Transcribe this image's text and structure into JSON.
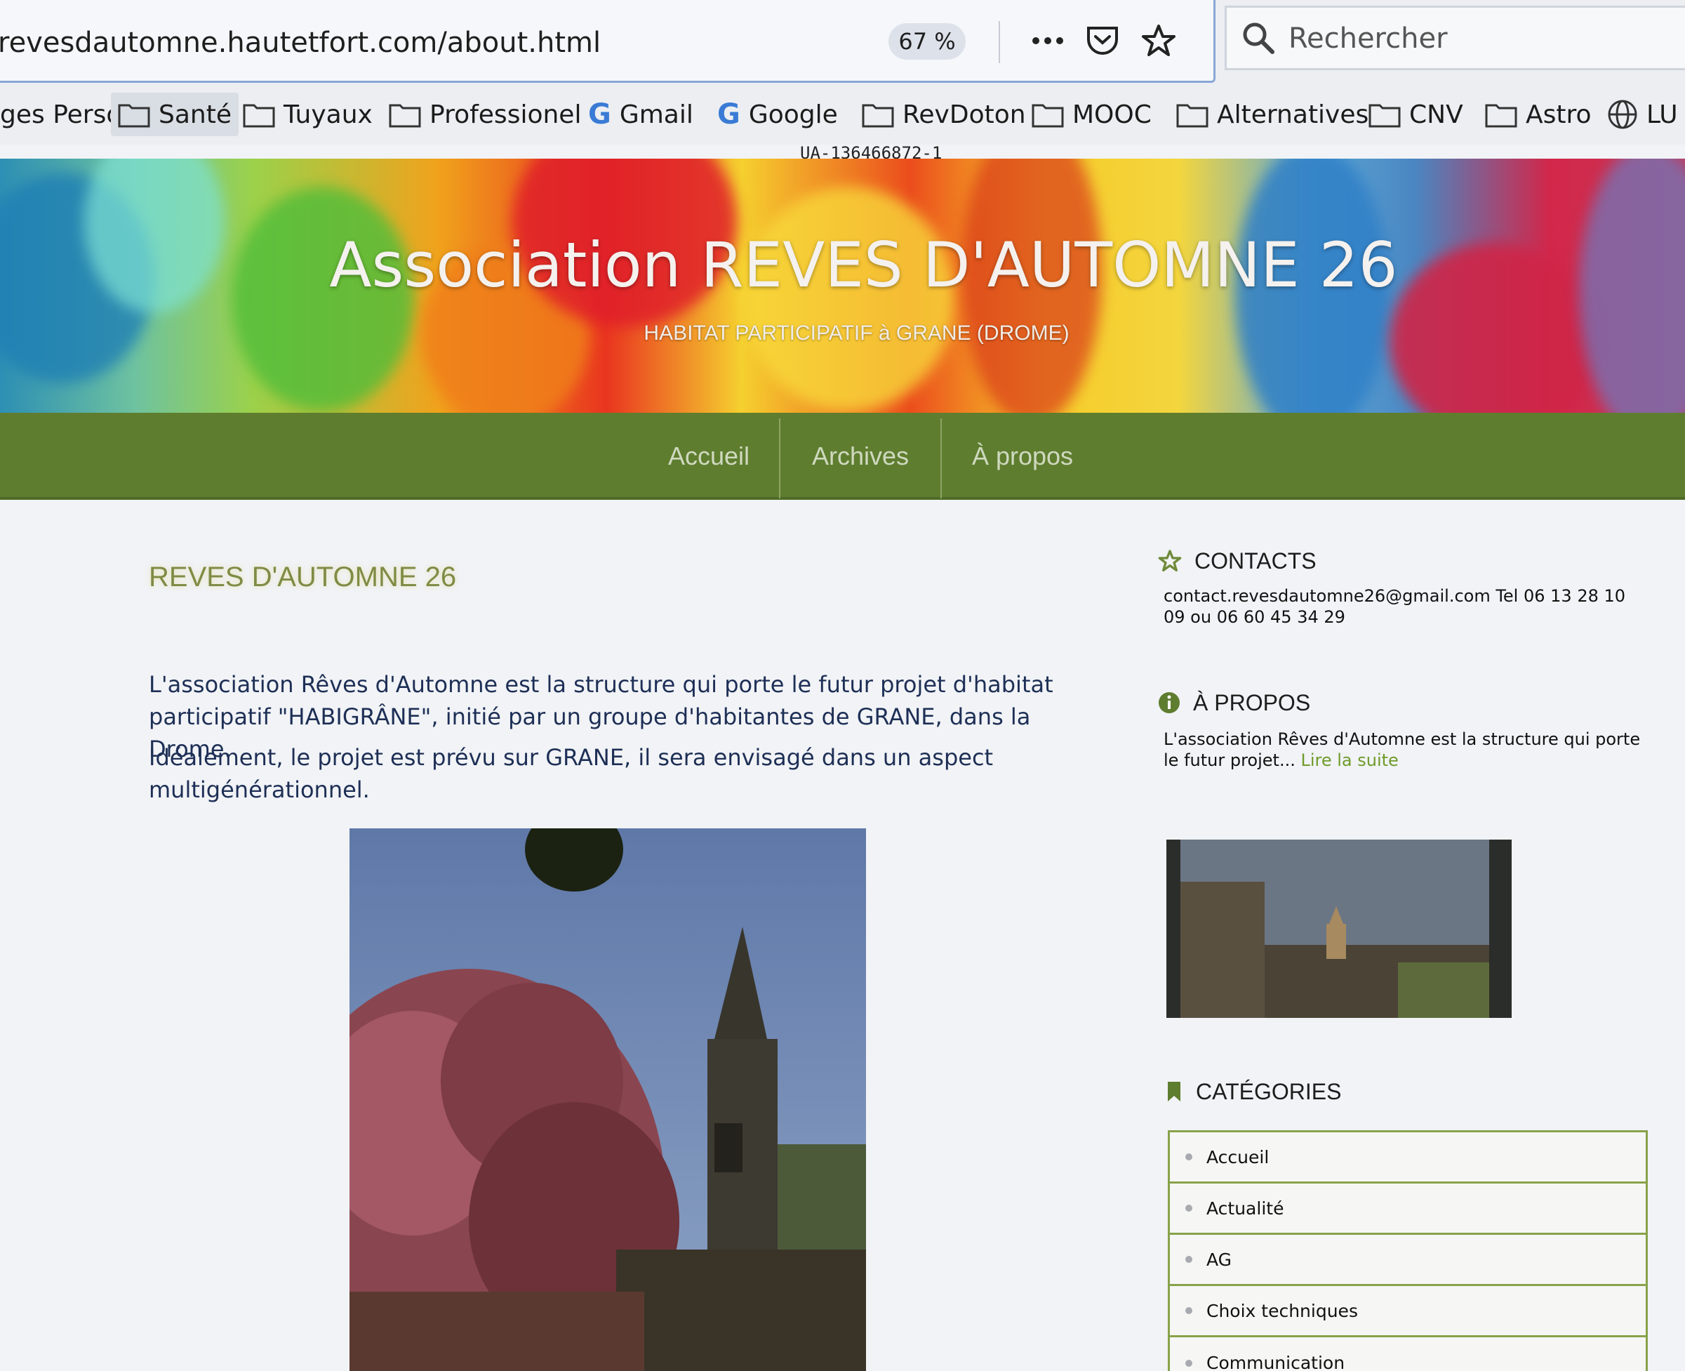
{
  "browser": {
    "url": "revesdautomne.hautetfort.com/about.html",
    "zoom": "67 %",
    "search_placeholder": "Rechercher",
    "icons": [
      "more-icon",
      "pocket-icon",
      "star-icon",
      "search-icon"
    ]
  },
  "bookmarks": [
    {
      "label": "ges Perso",
      "icon": "none"
    },
    {
      "label": "Santé",
      "icon": "folder-icon"
    },
    {
      "label": "Tuyaux",
      "icon": "folder-icon"
    },
    {
      "label": "Professionel",
      "icon": "folder-icon"
    },
    {
      "label": "Gmail",
      "icon": "google-icon"
    },
    {
      "label": "Google",
      "icon": "google-icon"
    },
    {
      "label": "RevDoton",
      "icon": "folder-icon"
    },
    {
      "label": "MOOC",
      "icon": "folder-icon"
    },
    {
      "label": "Alternatives",
      "icon": "folder-icon"
    },
    {
      "label": "CNV",
      "icon": "folder-icon"
    },
    {
      "label": "Astro",
      "icon": "folder-icon"
    },
    {
      "label": "LU",
      "icon": "globe-icon"
    }
  ],
  "tracking_code": "UA-136466872-1",
  "site": {
    "title": "Association REVES D'AUTOMNE 26",
    "subtitle": "HABITAT PARTICIPATIF à GRANE (DROME)"
  },
  "nav": [
    "Accueil",
    "Archives",
    "À propos"
  ],
  "post": {
    "title": "REVES D'AUTOMNE 26",
    "paragraph1": "L'association Rêves d'Automne est la structure qui porte le futur projet d'habitat participatif \"HABIGRÂNE\", initié par un groupe d'habitantes de GRANE, dans la Drome.",
    "paragraph2": "Idéalement, le projet est prévu sur GRANE, il sera envisagé dans un aspect multigénérationnel."
  },
  "sidebar": {
    "contacts": {
      "heading": "CONTACTS",
      "text": "contact.revesdautomne26@gmail.com Tel 06 13 28 10 09 ou 06 60 45 34 29"
    },
    "about": {
      "heading": "À PROPOS",
      "text": "L'association Rêves d'Automne est la structure qui porte le futur projet...",
      "read_more": "Lire la suite"
    },
    "categories": {
      "heading": "CATÉGORIES",
      "items": [
        "Accueil",
        "Actualité",
        "AG",
        "Choix techniques",
        "Communication"
      ]
    }
  },
  "colors": {
    "nav_green": "#5f7d2f",
    "accent_green": "#88a24a",
    "body_text": "#1e2f56"
  }
}
